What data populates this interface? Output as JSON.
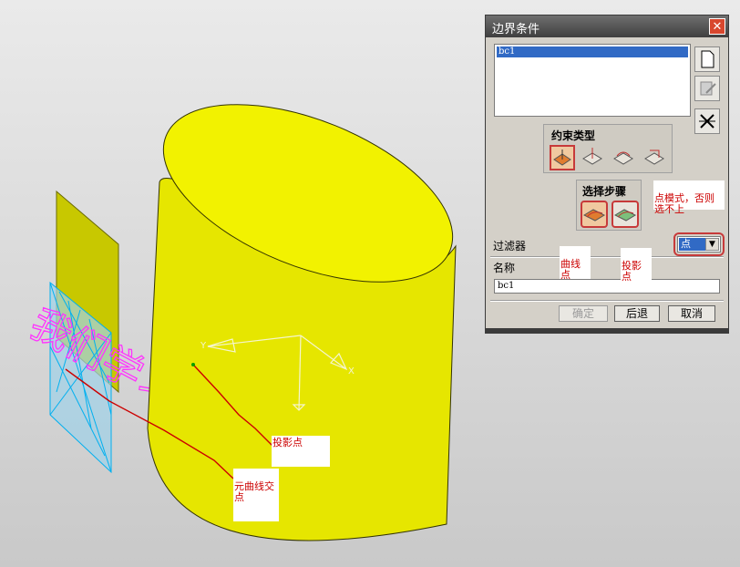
{
  "dialog": {
    "title": "边界条件",
    "list_items": [
      "bc1"
    ],
    "constraint_type_label": "约束类型",
    "selection_steps_label": "选择步骤",
    "filter_label": "过滤器",
    "filter_value": "点",
    "name_label": "名称",
    "name_value": "bc1",
    "buttons": {
      "ok": "确定",
      "back": "后退",
      "cancel": "取消"
    }
  },
  "annotations": {
    "curve_point": "曲线\n点",
    "projection_point_step": "投影\n点",
    "point_mode_note": "点模式，否则\n选不上",
    "projection_point": "投影点",
    "curve_intersection": "元曲线交\n点"
  },
  "scene": {
    "watermark": "我们学习",
    "axis_x": "X",
    "axis_y": "Y",
    "colors": {
      "cylinder": "#e6e600",
      "plate": "#c8c800",
      "mesh": "#00b0f0",
      "watermark": "#ff33ff",
      "sketch": "#cc0000"
    }
  }
}
